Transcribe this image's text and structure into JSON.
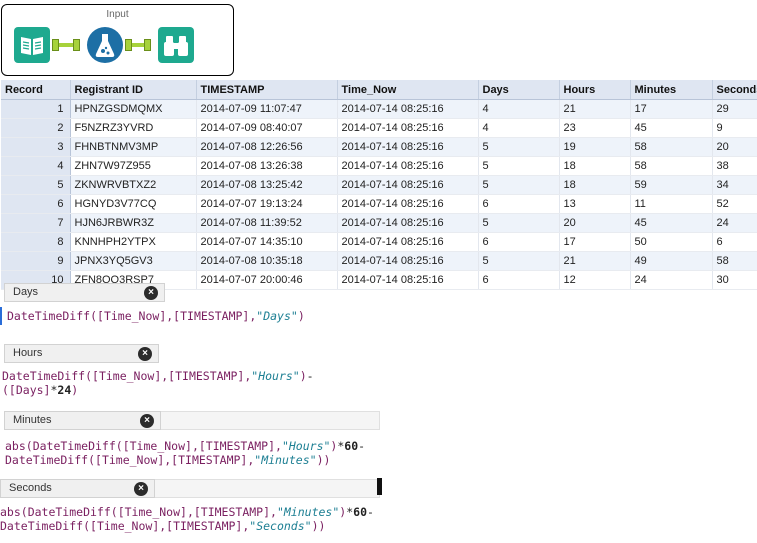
{
  "workflow": {
    "title": "Input",
    "tools": [
      {
        "name": "input-data-tool",
        "icon": "book-icon"
      },
      {
        "name": "formula-tool",
        "icon": "flask-icon"
      },
      {
        "name": "browse-tool",
        "icon": "binoculars-icon"
      }
    ]
  },
  "grid": {
    "columns": [
      "Record",
      "Registrant ID",
      "TIMESTAMP",
      "Time_Now",
      "Days",
      "Hours",
      "Minutes",
      "Seconds"
    ],
    "rows": [
      [
        "1",
        "HPNZGSDMQMX",
        "2014-07-09 11:07:47",
        "2014-07-14 08:25:16",
        "4",
        "21",
        "17",
        "29"
      ],
      [
        "2",
        "F5NZRZ3YVRD",
        "2014-07-09 08:40:07",
        "2014-07-14 08:25:16",
        "4",
        "23",
        "45",
        "9"
      ],
      [
        "3",
        "FHNBTNMV3MP",
        "2014-07-08 12:26:56",
        "2014-07-14 08:25:16",
        "5",
        "19",
        "58",
        "20"
      ],
      [
        "4",
        "ZHN7W97Z955",
        "2014-07-08 13:26:38",
        "2014-07-14 08:25:16",
        "5",
        "18",
        "58",
        "38"
      ],
      [
        "5",
        "ZKNWRVBTXZ2",
        "2014-07-08 13:25:42",
        "2014-07-14 08:25:16",
        "5",
        "18",
        "59",
        "34"
      ],
      [
        "6",
        "HGNYD3V77CQ",
        "2014-07-07 19:13:24",
        "2014-07-14 08:25:16",
        "6",
        "13",
        "11",
        "52"
      ],
      [
        "7",
        "HJN6JRBWR3Z",
        "2014-07-08 11:39:52",
        "2014-07-14 08:25:16",
        "5",
        "20",
        "45",
        "24"
      ],
      [
        "8",
        "KNNHPH2YTPX",
        "2014-07-07 14:35:10",
        "2014-07-14 08:25:16",
        "6",
        "17",
        "50",
        "6"
      ],
      [
        "9",
        "JPNX3YQ5GV3",
        "2014-07-08 10:35:18",
        "2014-07-14 08:25:16",
        "5",
        "21",
        "49",
        "58"
      ],
      [
        "10",
        "ZFN8QQ3RSP7",
        "2014-07-07 20:00:46",
        "2014-07-14 08:25:16",
        "6",
        "12",
        "24",
        "30"
      ]
    ]
  },
  "formulas": {
    "days": {
      "name": "Days",
      "close": "×"
    },
    "hours": {
      "name": "Hours",
      "close": "×"
    },
    "minutes": {
      "name": "Minutes",
      "close": "×"
    },
    "seconds": {
      "name": "Seconds",
      "close": "×"
    }
  },
  "expr": {
    "fn_dtd": "DateTimeDiff(",
    "args": "[Time_Now],[TIMESTAMP],",
    "q_days": "\"Days\"",
    "q_hours": "\"Hours\"",
    "q_minutes": "\"Minutes\"",
    "q_seconds": "\"Seconds\"",
    "close_paren": ")",
    "close_paren2": "))",
    "minus": "-",
    "days_field": "([Days]",
    "times": "*",
    "n24": "24",
    "close_paren_after24": ")",
    "abs_dtd": "abs(DateTimeDiff(",
    "n60": "60",
    "minus_end": "-"
  }
}
